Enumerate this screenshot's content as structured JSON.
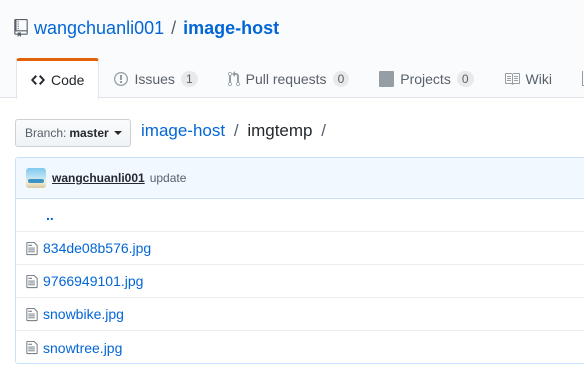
{
  "repo": {
    "owner": "wangchuanli001",
    "separator": "/",
    "name": "image-host"
  },
  "tabs": [
    {
      "label": "Code",
      "icon": "code-icon",
      "selected": true
    },
    {
      "label": "Issues",
      "icon": "issue-icon",
      "count": "1"
    },
    {
      "label": "Pull requests",
      "icon": "pull-request-icon",
      "count": "0"
    },
    {
      "label": "Projects",
      "icon": "project-icon",
      "count": "0"
    },
    {
      "label": "Wiki",
      "icon": "book-icon"
    },
    {
      "label": "",
      "icon": "graph-icon"
    }
  ],
  "branch": {
    "label": "Branch:",
    "value": "master"
  },
  "breadcrumb": {
    "repo": "image-host",
    "dir": "imgtemp",
    "separator": "/"
  },
  "commit": {
    "author": "wangchuanli001",
    "message": "update"
  },
  "files": {
    "up_label": "..",
    "items": [
      {
        "name": "834de08b576.jpg"
      },
      {
        "name": "9766949101.jpg"
      },
      {
        "name": "snowbike.jpg"
      },
      {
        "name": "snowtree.jpg"
      }
    ]
  },
  "colors": {
    "link": "#0366d6",
    "tab_accent": "#e36209",
    "commit_bar": "#f1f8ff",
    "border_blue": "#c8e1ff"
  }
}
